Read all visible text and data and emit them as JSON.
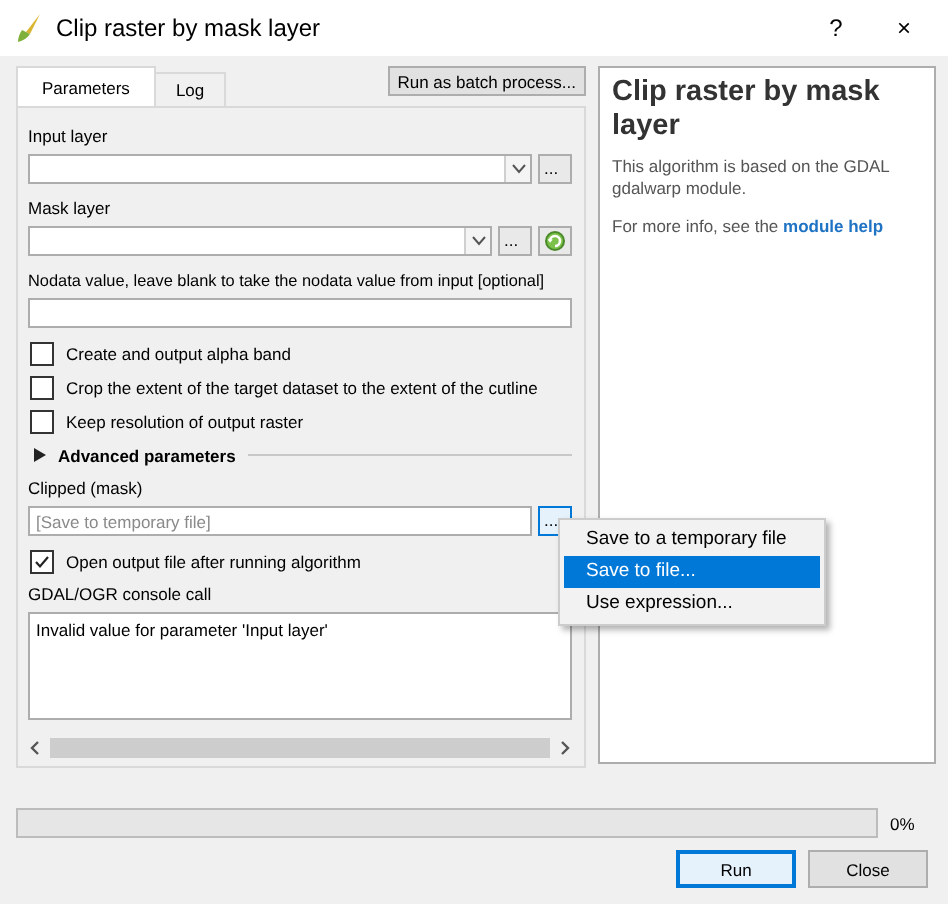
{
  "window": {
    "title": "Clip raster by mask layer",
    "help_button": "?",
    "close_button": "×"
  },
  "tabs": [
    {
      "label": "Parameters",
      "selected": true
    },
    {
      "label": "Log",
      "selected": false
    }
  ],
  "batch_button": "Run as batch process...",
  "parameters": [
    {
      "kind": "combo",
      "label": "Input layer",
      "browse_button": "...",
      "refresh": false
    },
    {
      "kind": "combo",
      "label": "Mask layer",
      "browse_button": "...",
      "refresh": true
    },
    {
      "kind": "text",
      "label": "Nodata value, leave blank to take the nodata value from input [optional]"
    },
    {
      "kind": "checkbox",
      "label": "Create and output alpha band",
      "checked": false
    },
    {
      "kind": "checkbox",
      "label": "Crop the extent of the target dataset to the extent of the cutline",
      "checked": false
    },
    {
      "kind": "checkbox",
      "label": "Keep resolution of output raster",
      "checked": false
    },
    {
      "kind": "section",
      "label": "Advanced parameters",
      "expanded": false
    },
    {
      "kind": "output",
      "label": "Clipped (mask)",
      "placeholder": "[Save to temporary file]",
      "browse_button": "..."
    },
    {
      "kind": "checkbox",
      "label": "Open output file after running algorithm",
      "checked": true
    }
  ],
  "console": {
    "label": "GDAL/OGR console call",
    "text": "Invalid value for parameter 'Input layer'"
  },
  "help": {
    "title": "Clip raster by mask layer",
    "description": "This algorithm is based on the GDAL gdalwarp module.",
    "more_info": "For more info, see the",
    "link": "module help"
  },
  "menu": [
    {
      "label": "Save to a temporary file",
      "selected": false
    },
    {
      "label": "Save to file...",
      "selected": true
    },
    {
      "label": "Use expression...",
      "selected": false
    }
  ],
  "progress": {
    "level": 0,
    "reading": "0%"
  },
  "buttons": [
    {
      "label": "Run",
      "default": true
    },
    {
      "label": "Close",
      "default": false
    }
  ]
}
